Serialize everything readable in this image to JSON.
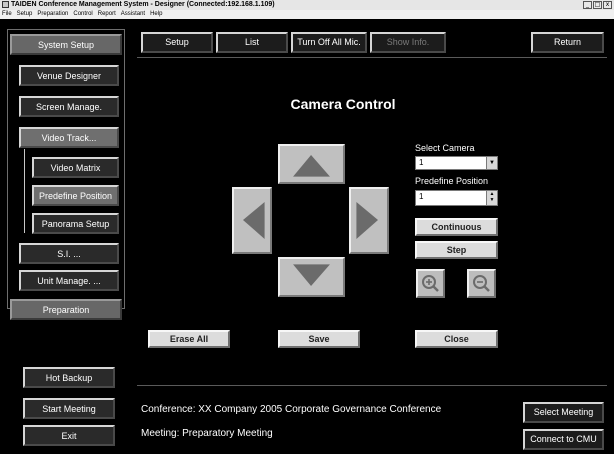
{
  "window": {
    "title": "TAIDEN Conference Management System - Designer (Connected:192.168.1.109)",
    "controls": [
      "_",
      "□",
      "x"
    ]
  },
  "menu": [
    "File",
    "Setup",
    "Preparation",
    "Control",
    "Report",
    "Assistant",
    "Help"
  ],
  "sidebar": {
    "system_setup": "System Setup",
    "venue_designer": "Venue Designer",
    "screen_manage": "Screen Manage.",
    "video_track": "Video Track...",
    "video_matrix": "Video Matrix",
    "predefine_position": "Predefine Position",
    "panorama_setup": "Panorama Setup",
    "si": "S.I. ...",
    "unit_manage": "Unit Manage. ...",
    "preparation": "Preparation",
    "hot_backup": "Hot Backup",
    "start_meeting": "Start Meeting",
    "exit": "Exit"
  },
  "toolbar": {
    "setup": "Setup",
    "list": "List",
    "turn_off_all_mic": "Turn Off All Mic.",
    "show_info": "Show Info.",
    "return": "Return"
  },
  "main": {
    "title": "Camera Control",
    "select_camera_label": "Select Camera",
    "select_camera_value": "1",
    "predefine_position_label": "Predefine Position",
    "predefine_position_value": "1",
    "continuous": "Continuous",
    "step": "Step",
    "erase_all": "Erase All",
    "save": "Save",
    "close": "Close"
  },
  "icons": {
    "up": "arrow-up-icon",
    "down": "arrow-down-icon",
    "left": "arrow-left-icon",
    "right": "arrow-right-icon",
    "zoom_in": "zoom-in-icon",
    "zoom_out": "zoom-out-icon"
  },
  "footer": {
    "conference": "Conference: XX Company 2005 Corporate Governance Conference",
    "meeting": "Meeting: Preparatory Meeting",
    "select_meeting": "Select Meeting",
    "connect_to_cmu": "Connect to CMU"
  },
  "colors": {
    "background": "#000000",
    "button_face": "#c0c0c0",
    "arrow": "#6b6b6b"
  }
}
